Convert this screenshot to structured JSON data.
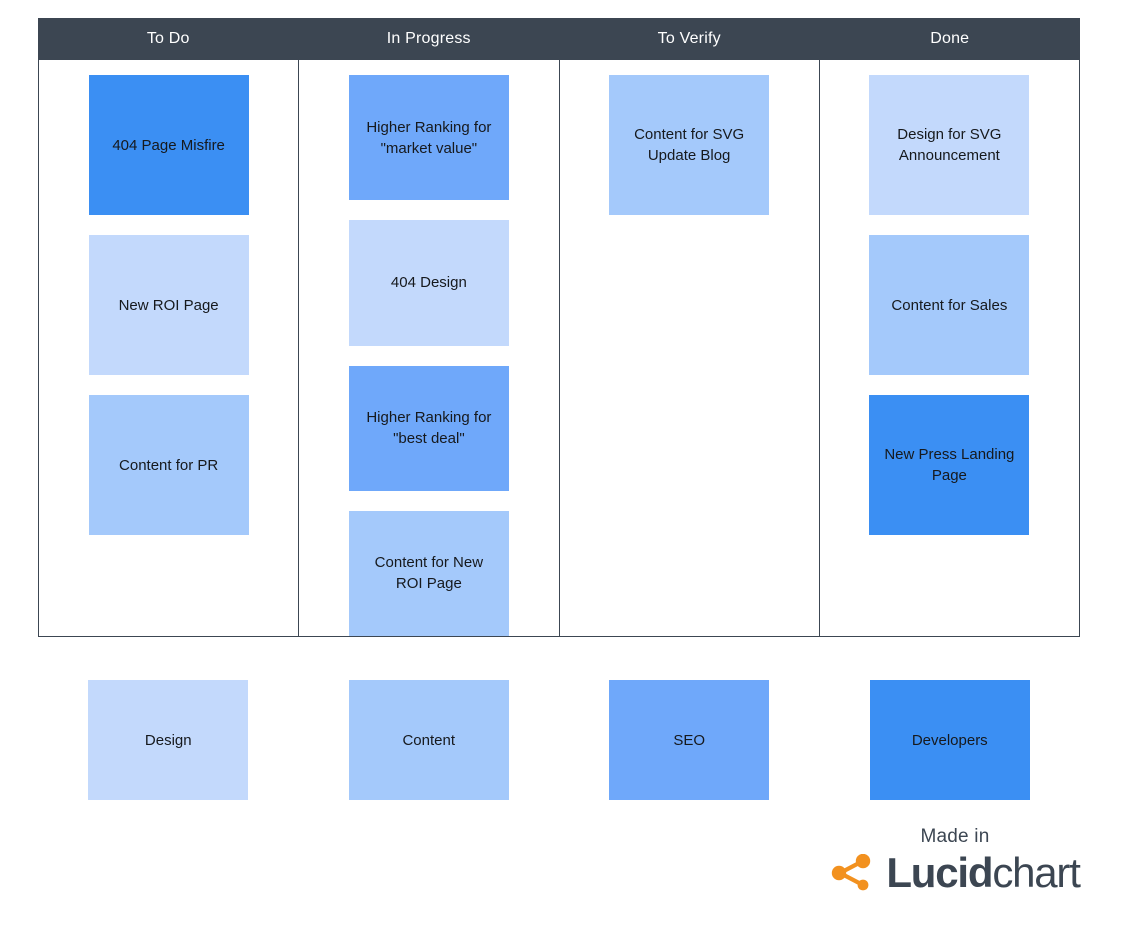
{
  "board": {
    "columns": [
      {
        "title": "To Do",
        "cards": [
          {
            "text": "404 Page Misfire",
            "category": "Developers",
            "color": "#3b8ff3"
          },
          {
            "text": "New ROI Page",
            "category": "Design",
            "color": "#c3d9fc"
          },
          {
            "text": "Content for PR",
            "category": "Content",
            "color": "#a4c9fb"
          }
        ]
      },
      {
        "title": "In Progress",
        "cards": [
          {
            "text": "Higher Ranking for\n\"market value\"",
            "category": "SEO",
            "color": "#6fa8fa"
          },
          {
            "text": "404 Design",
            "category": "Design",
            "color": "#c3d9fc"
          },
          {
            "text": "Higher Ranking for\n\"best deal\"",
            "category": "SEO",
            "color": "#6fa8fa"
          },
          {
            "text": "Content for New\nROI Page",
            "category": "Content",
            "color": "#a4c9fb"
          }
        ]
      },
      {
        "title": "To Verify",
        "cards": [
          {
            "text": "Content for SVG\nUpdate Blog",
            "category": "Content",
            "color": "#a4c9fb"
          }
        ]
      },
      {
        "title": "Done",
        "cards": [
          {
            "text": "Design for SVG\nAnnouncement",
            "category": "Design",
            "color": "#c3d9fc"
          },
          {
            "text": "Content for Sales",
            "category": "Content",
            "color": "#a4c9fb"
          },
          {
            "text": "New Press Landing\nPage",
            "category": "Developers",
            "color": "#3b8ff3"
          }
        ]
      }
    ]
  },
  "legend": [
    {
      "label": "Design",
      "color": "#c3d9fc"
    },
    {
      "label": "Content",
      "color": "#a4c9fb"
    },
    {
      "label": "SEO",
      "color": "#6fa8fa"
    },
    {
      "label": "Developers",
      "color": "#3b8ff3"
    }
  ],
  "attribution": {
    "made_in": "Made in",
    "brand_bold": "Lucid",
    "brand_light": "chart",
    "mark_color": "#f2911f",
    "word_color": "#3c4652"
  },
  "theme": {
    "header_bg": "#3c4652",
    "header_text": "#ffffff",
    "border": "#3c4652",
    "page_bg": "#ffffff",
    "card_text": "#16191d"
  }
}
